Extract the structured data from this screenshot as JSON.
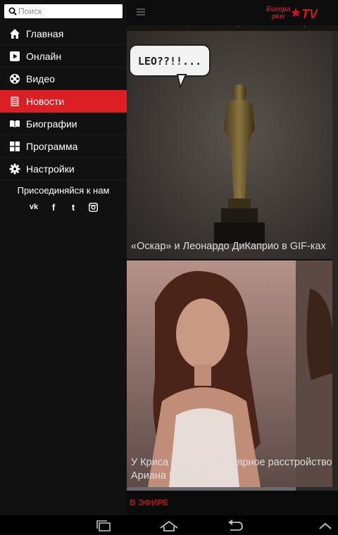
{
  "search": {
    "placeholder": "Поиск"
  },
  "nav": {
    "items": [
      {
        "label": "Главная",
        "icon": "home-icon",
        "active": false
      },
      {
        "label": "Онлайн",
        "icon": "play-icon",
        "active": false
      },
      {
        "label": "Видео",
        "icon": "film-reel-icon",
        "active": false
      },
      {
        "label": "Новости",
        "icon": "document-icon",
        "active": true
      },
      {
        "label": "Биографии",
        "icon": "book-icon",
        "active": false
      },
      {
        "label": "Программа",
        "icon": "grid-icon",
        "active": false
      },
      {
        "label": "Настройки",
        "icon": "gear-icon",
        "active": false
      }
    ]
  },
  "social": {
    "heading": "Присоединяйся к нам",
    "links": [
      {
        "icon": "vk-icon",
        "glyph": "vk"
      },
      {
        "icon": "facebook-icon",
        "glyph": "f"
      },
      {
        "icon": "twitter-icon",
        "glyph": "t"
      },
      {
        "icon": "instagram-icon",
        "glyph": ""
      }
    ]
  },
  "header": {
    "logo_text": "Europa plus TV"
  },
  "news": {
    "cards": [
      {
        "title": "«Оскар» и Леонардо ДиКаприо в GIF-ках",
        "speech_bubble": "LEO??!!..."
      },
      {
        "title": "У Криса Брауна биполярное расстройство, Ариана Гранде"
      }
    ]
  },
  "player": {
    "on_air_label": "В ЭФИРЕ",
    "progress": 0.8
  },
  "colors": {
    "accent": "#db1f25",
    "drawer_bg": "#111111"
  }
}
